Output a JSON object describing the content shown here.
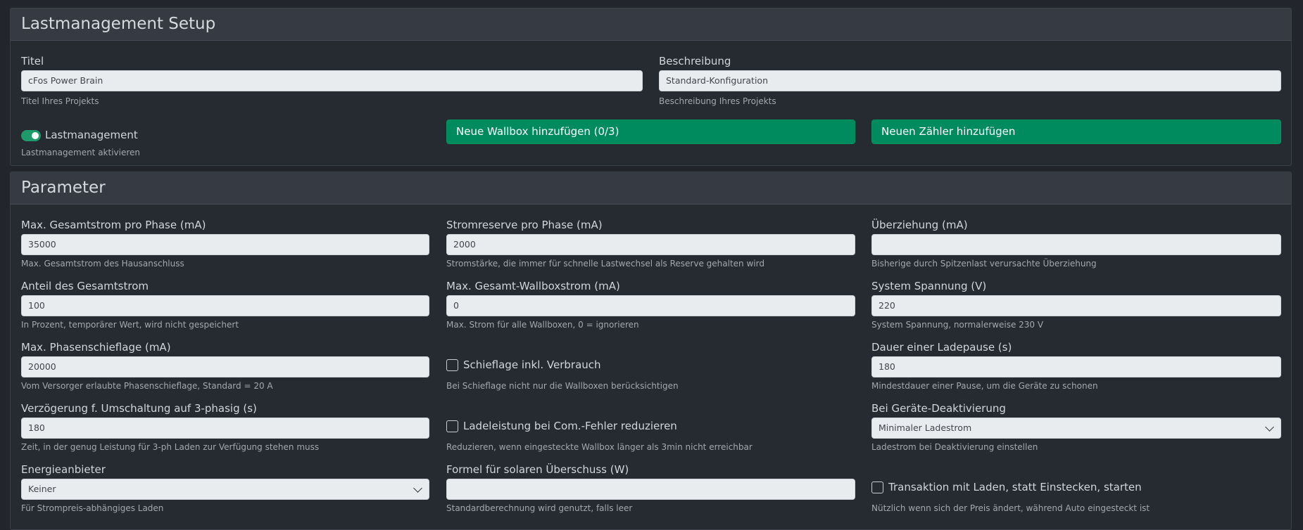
{
  "setup": {
    "title": "Lastmanagement Setup",
    "titel_label": "Titel",
    "titel_value": "cFos Power Brain",
    "titel_hint": "Titel Ihres Projekts",
    "beschreibung_label": "Beschreibung",
    "beschreibung_value": "Standard-Konfiguration",
    "beschreibung_hint": "Beschreibung Ihres Projekts",
    "lastmanagement_label": "Lastmanagement",
    "lastmanagement_enabled": true,
    "lastmanagement_hint": "Lastmanagement aktivieren",
    "add_wallbox_label": "Neue Wallbox hinzufügen (0/3)",
    "add_meter_label": "Neuen Zähler hinzufügen"
  },
  "parameter": {
    "title": "Parameter",
    "max_gesamtstrom_label": "Max. Gesamtstrom pro Phase (mA)",
    "max_gesamtstrom_value": "35000",
    "max_gesamtstrom_hint": "Max. Gesamtstrom des Hausanschluss",
    "stromreserve_label": "Stromreserve pro Phase (mA)",
    "stromreserve_value": "2000",
    "stromreserve_hint": "Stromstärke, die immer für schnelle Lastwechsel als Reserve gehalten wird",
    "ueberziehung_label": "Überziehung (mA)",
    "ueberziehung_value": "",
    "ueberziehung_hint": "Bisherige durch Spitzenlast verursachte Überziehung",
    "anteil_label": "Anteil des Gesamtstrom",
    "anteil_value": "100",
    "anteil_hint": "In Prozent, temporärer Wert, wird nicht gespeichert",
    "max_wallboxstrom_label": "Max. Gesamt-Wallboxstrom (mA)",
    "max_wallboxstrom_value": "0",
    "max_wallboxstrom_hint": "Max. Strom für alle Wallboxen, 0 = ignorieren",
    "system_spannung_label": "System Spannung (V)",
    "system_spannung_value": "220",
    "system_spannung_hint": "System Spannung, normalerweise 230 V",
    "phasenschieflage_label": "Max. Phasenschieflage (mA)",
    "phasenschieflage_value": "20000",
    "phasenschieflage_hint": "Vom Versorger erlaubte Phasenschieflage, Standard = 20 A",
    "schieflage_checkbox_label": "Schieflage inkl. Verbrauch",
    "schieflage_checkbox_hint": "Bei Schieflage nicht nur die Wallboxen berücksichtigen",
    "ladepause_label": "Dauer einer Ladepause (s)",
    "ladepause_value": "180",
    "ladepause_hint": "Mindestdauer einer Pause, um die Geräte zu schonen",
    "verzoegerung_label": "Verzögerung f. Umschaltung auf 3-phasig (s)",
    "verzoegerung_value": "180",
    "verzoegerung_hint": "Zeit, in der genug Leistung für 3-ph Laden zur Verfügung stehen muss",
    "ladeleistung_checkbox_label": "Ladeleistung bei Com.-Fehler reduzieren",
    "ladeleistung_checkbox_hint": "Reduzieren, wenn eingesteckte Wallbox länger als 3min nicht erreichbar",
    "deaktivierung_label": "Bei Geräte-Deaktivierung",
    "deaktivierung_value": "Minimaler Ladestrom",
    "deaktivierung_hint": "Ladestrom bei Deaktivierung einstellen",
    "energieanbieter_label": "Energieanbieter",
    "energieanbieter_value": "Keiner",
    "energieanbieter_hint": "Für Strompreis-abhängiges Laden",
    "formel_label": "Formel für solaren Überschuss (W)",
    "formel_value": "",
    "formel_hint": "Standardberechnung wird genutzt, falls leer",
    "transaktion_checkbox_label": "Transaktion mit Laden, statt Einstecken, starten",
    "transaktion_checkbox_hint": "Nützlich wenn sich der Preis ändert, während Auto eingesteckt ist"
  }
}
